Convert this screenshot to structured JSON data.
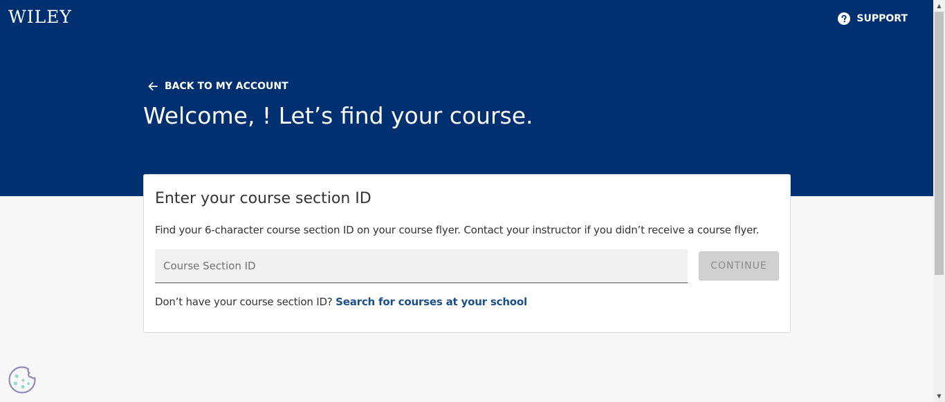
{
  "header": {
    "logo": "WILEY",
    "support_label": "SUPPORT",
    "support_icon": "help-circle-icon",
    "background_color": "#003070"
  },
  "hero": {
    "back_label": "BACK TO MY ACCOUNT",
    "back_icon": "arrow-left-icon",
    "welcome": "Welcome, ! Let’s find your course."
  },
  "card": {
    "title": "Enter your course section ID",
    "description": "Find your 6-character course section ID on your course flyer. Contact your instructor if you didn’t receive a course flyer.",
    "input_value": "",
    "input_placeholder": "Course Section ID",
    "continue_label": "CONTINUE",
    "helper_text": "Don’t have your course section ID?",
    "search_link": "Search for courses at your school",
    "link_color": "#1c4f8a"
  },
  "cookie": {
    "icon": "cookie-icon"
  }
}
